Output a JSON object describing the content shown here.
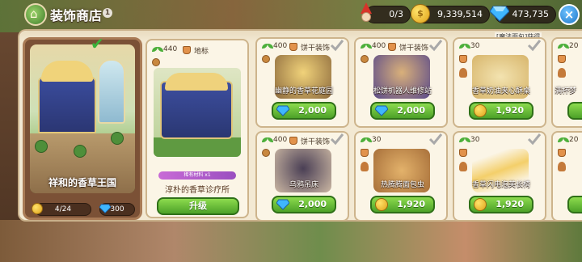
{
  "header": {
    "title": "装饰商店",
    "info_badge": "1",
    "gnome_count": "0/3",
    "coins": "9,339,514",
    "gems": "473,735",
    "close_label": "×"
  },
  "kingdom": {
    "name": "祥和的香草王国",
    "coin_progress": "4/24",
    "gem_count": "300"
  },
  "featured": {
    "sprout_count": "440",
    "tag": "地标",
    "material_bar": "稀有材料 x1",
    "name": "淳朴的香草诊疗所",
    "upgrade_label": "升级"
  },
  "tooltip": "[魔法面包]获得",
  "cards": [
    {
      "sprout": "400",
      "category": "饼干装饰",
      "name": "幽静的香草花庭园",
      "price": "2,000",
      "currency": "gem",
      "checked": true
    },
    {
      "sprout": "400",
      "category": "饼干装饰",
      "name": "松饼机器人维修站",
      "price": "2,000",
      "currency": "gem",
      "checked": true
    },
    {
      "sprout": "30",
      "category": "",
      "name": "香草奶油夹心酥桌",
      "price": "1,920",
      "currency": "coin",
      "checked": true
    },
    {
      "sprout": "20",
      "category": "",
      "name": "满杯梦",
      "price": "",
      "currency": "",
      "checked": false
    },
    {
      "sprout": "400",
      "category": "饼干装饰",
      "name": "乌鸦吊床",
      "price": "2,000",
      "currency": "gem",
      "checked": true
    },
    {
      "sprout": "30",
      "category": "",
      "name": "热腾腾面包虫",
      "price": "1,920",
      "currency": "coin",
      "checked": true
    },
    {
      "sprout": "30",
      "category": "",
      "name": "香草闪电泡芙长椅",
      "price": "1,920",
      "currency": "coin",
      "checked": true
    },
    {
      "sprout": "20",
      "category": "",
      "name": "",
      "price": "",
      "currency": "",
      "checked": false
    }
  ],
  "colors": {
    "button_green": "#4ca128",
    "panel_cream": "#f3e9d3",
    "close_blue": "#1f77c9"
  },
  "icons": [
    "shop-icon",
    "info-icon",
    "gnome-icon",
    "coin-icon",
    "gem-icon",
    "close-icon",
    "sprout-icon",
    "check-icon",
    "cookie-icon",
    "pot-icon"
  ]
}
